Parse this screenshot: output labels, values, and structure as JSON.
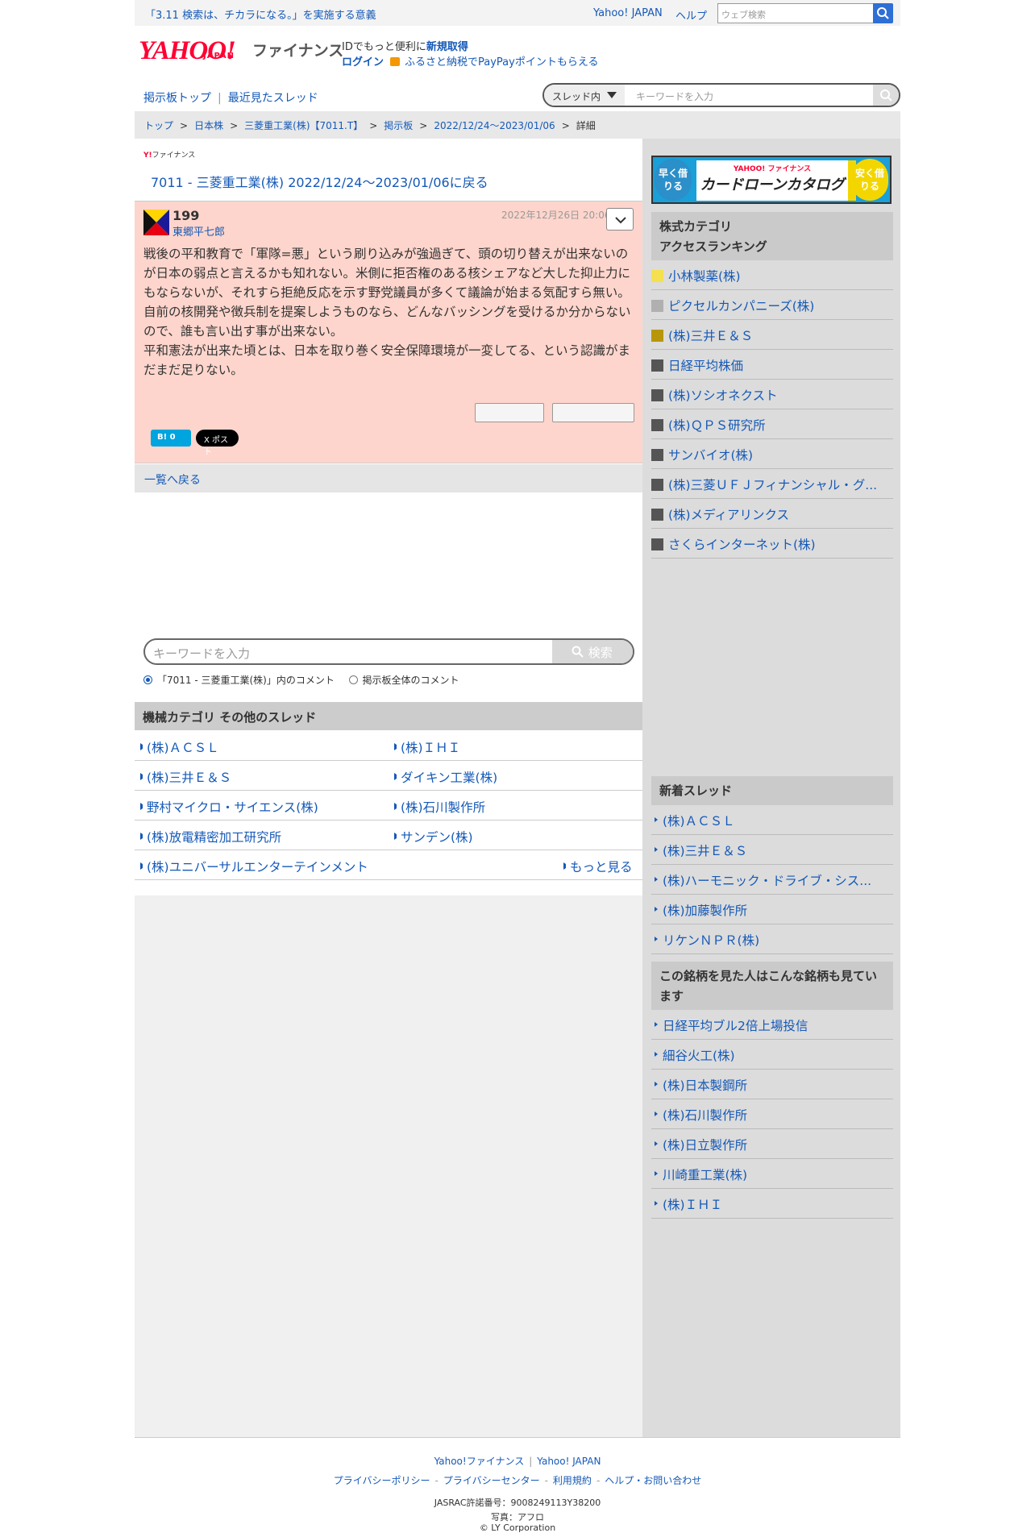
{
  "topbar": {
    "campaign": "「3.11 検索は、チカラになる。」を実施する意義",
    "yahoo_japan": "Yahoo! JAPAN",
    "help": "ヘルプ",
    "web_search_placeholder": "ウェブ検索"
  },
  "header": {
    "logo": "YAHOO!",
    "logo_sub": "JAPAN",
    "finance": "ファイナンス",
    "id_text": "IDでもっと便利に",
    "register": "新規取得",
    "login": "ログイン",
    "furusato": "ふるさと納税でPayPayポイントもらえる"
  },
  "boardnav": {
    "top": "掲示板トップ",
    "recent": "最近見たスレッド",
    "scope": "スレッド内",
    "keyword_placeholder": "キーワードを入力"
  },
  "breadcrumb": [
    "トップ",
    "日本株",
    "三菱重工業(株)【7011.T】",
    "掲示板",
    "2022/12/24〜2023/01/06",
    "詳細"
  ],
  "main": {
    "small_logo": "Y!",
    "small_logo_text": "ファイナンス",
    "back_link": "7011 - 三菱重工業(株) 2022/12/24〜2023/01/06に戻る",
    "post": {
      "number": "199",
      "author": "東郷平七郎",
      "date": "2022年12月26日 20:06",
      "body": "戦後の平和教育で「軍隊=悪」という刷り込みが強過ぎて、頭の切り替えが出来ないのが日本の弱点と言えるかも知れない。米側に拒否権のある核シェアなど大した抑止力にもならないが、それすら拒絶反応を示す野党議員が多くて議論が始まる気配すら無い。自前の核開発や徴兵制を提案しようものなら、どんなバッシングを受けるか分からないので、誰も言い出す事が出来ない。\n平和憲法が出来た頃とは、日本を取り巻く安全保障環境が一変してる、という認識がまだまだ足りない。",
      "hatena": "B! 0",
      "x_post": "X ポスト"
    },
    "list_back": "一覧へ戻る",
    "keyword_placeholder": "キーワードを入力",
    "search_button": "検索",
    "radio_thread": "「7011 - 三菱重工業(株)」内のコメント",
    "radio_all": "掲示板全体のコメント",
    "other_head": "機械カテゴリ  その他のスレッド",
    "other_threads": [
      [
        "(株)ＡＣＳＬ",
        "(株)ＩＨＩ"
      ],
      [
        "(株)三井Ｅ＆Ｓ",
        "ダイキン工業(株)"
      ],
      [
        "野村マイクロ・サイエンス(株)",
        "(株)石川製作所"
      ],
      [
        "(株)放電精密加工研究所",
        "サンデン(株)"
      ],
      [
        "(株)ユニバーサルエンターテインメント",
        "もっと見る"
      ]
    ]
  },
  "ad": {
    "left": "早く借りる",
    "brand": "YAHOO! ファイナンス",
    "title": "カードローンカタログ",
    "right": "安く借りる"
  },
  "ranking": {
    "title": "株式カテゴリ\nアクセスランキング",
    "items": [
      {
        "name": "小林製薬(株)",
        "color": "#f5e050"
      },
      {
        "name": "ピクセルカンパニーズ(株)",
        "color": "#b0b0b0"
      },
      {
        "name": "(株)三井Ｅ＆Ｓ",
        "color": "#b8960c"
      },
      {
        "name": "日経平均株価",
        "color": "#555555"
      },
      {
        "name": "(株)ソシオネクスト",
        "color": "#555555"
      },
      {
        "name": "(株)ＱＰＳ研究所",
        "color": "#555555"
      },
      {
        "name": "サンバイオ(株)",
        "color": "#555555"
      },
      {
        "name": "(株)三菱ＵＦＪフィナンシャル・グ...",
        "color": "#555555"
      },
      {
        "name": "(株)メディアリンクス",
        "color": "#555555"
      },
      {
        "name": "さくらインターネット(株)",
        "color": "#555555"
      }
    ]
  },
  "new_threads": {
    "title": "新着スレッド",
    "items": [
      "(株)ＡＣＳＬ",
      "(株)三井Ｅ＆Ｓ",
      "(株)ハーモニック・ドライブ・シス...",
      "(株)加藤製作所",
      "リケンＮＰＲ(株)"
    ]
  },
  "also_viewed": {
    "title": "この銘柄を見た人はこんな銘柄も見ています",
    "items": [
      "日経平均ブル2倍上場投信",
      "細谷火工(株)",
      "(株)日本製鋼所",
      "(株)石川製作所",
      "(株)日立製作所",
      "川崎重工業(株)",
      "(株)ＩＨＩ"
    ]
  },
  "footer": {
    "links1": [
      "Yahoo!ファイナンス",
      "Yahoo! JAPAN"
    ],
    "links2": [
      "プライバシーポリシー",
      "プライバシーセンター",
      "利用規約",
      "ヘルプ・お問い合わせ"
    ],
    "jasrac": "JASRAC許諾番号：9008249113Y38200",
    "photo": "写真：アフロ",
    "copyright": "© LY Corporation"
  }
}
